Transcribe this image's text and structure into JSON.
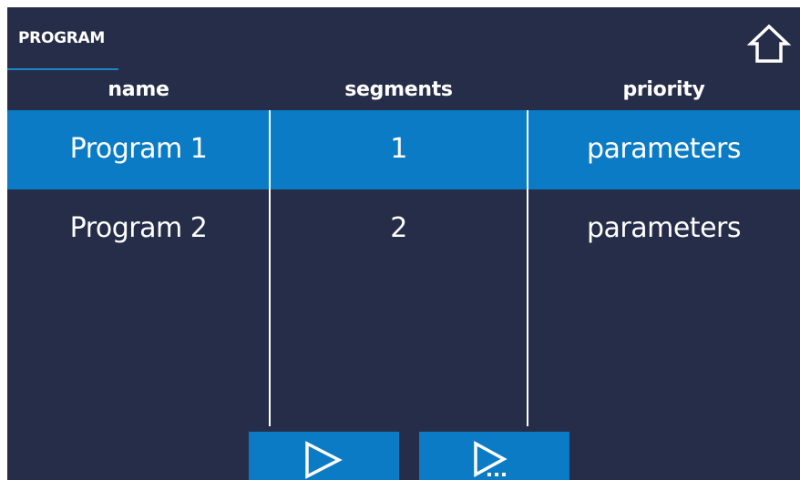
{
  "header": {
    "title": "PROGRAM",
    "home_icon": "home-icon"
  },
  "table": {
    "columns": [
      "name",
      "segments",
      "priority"
    ],
    "rows": [
      {
        "name": "Program 1",
        "segments": "1",
        "priority": "parameters",
        "selected": true
      },
      {
        "name": "Program 2",
        "segments": "2",
        "priority": "parameters",
        "selected": false
      }
    ]
  },
  "footer": {
    "buttons": [
      {
        "icon": "play-icon"
      },
      {
        "icon": "play-from-segment-icon"
      }
    ]
  },
  "colors": {
    "background": "#262d48",
    "accent": "#0a7bc4",
    "text": "#ffffff"
  }
}
